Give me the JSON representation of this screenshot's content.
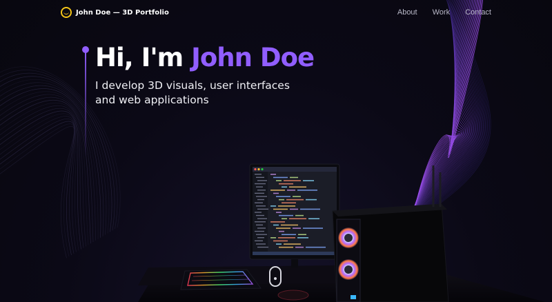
{
  "navbar": {
    "brand": "John Doe — 3D Portfolio",
    "links": [
      "About",
      "Work",
      "Contact"
    ]
  },
  "hero": {
    "greeting": "Hi, I'm ",
    "name": "John Doe",
    "subtitle": "I develop 3D visuals, user interfaces and web applications"
  },
  "colors": {
    "accent": "#915eff",
    "logo": "#f5c518",
    "background": "#0b0916"
  }
}
